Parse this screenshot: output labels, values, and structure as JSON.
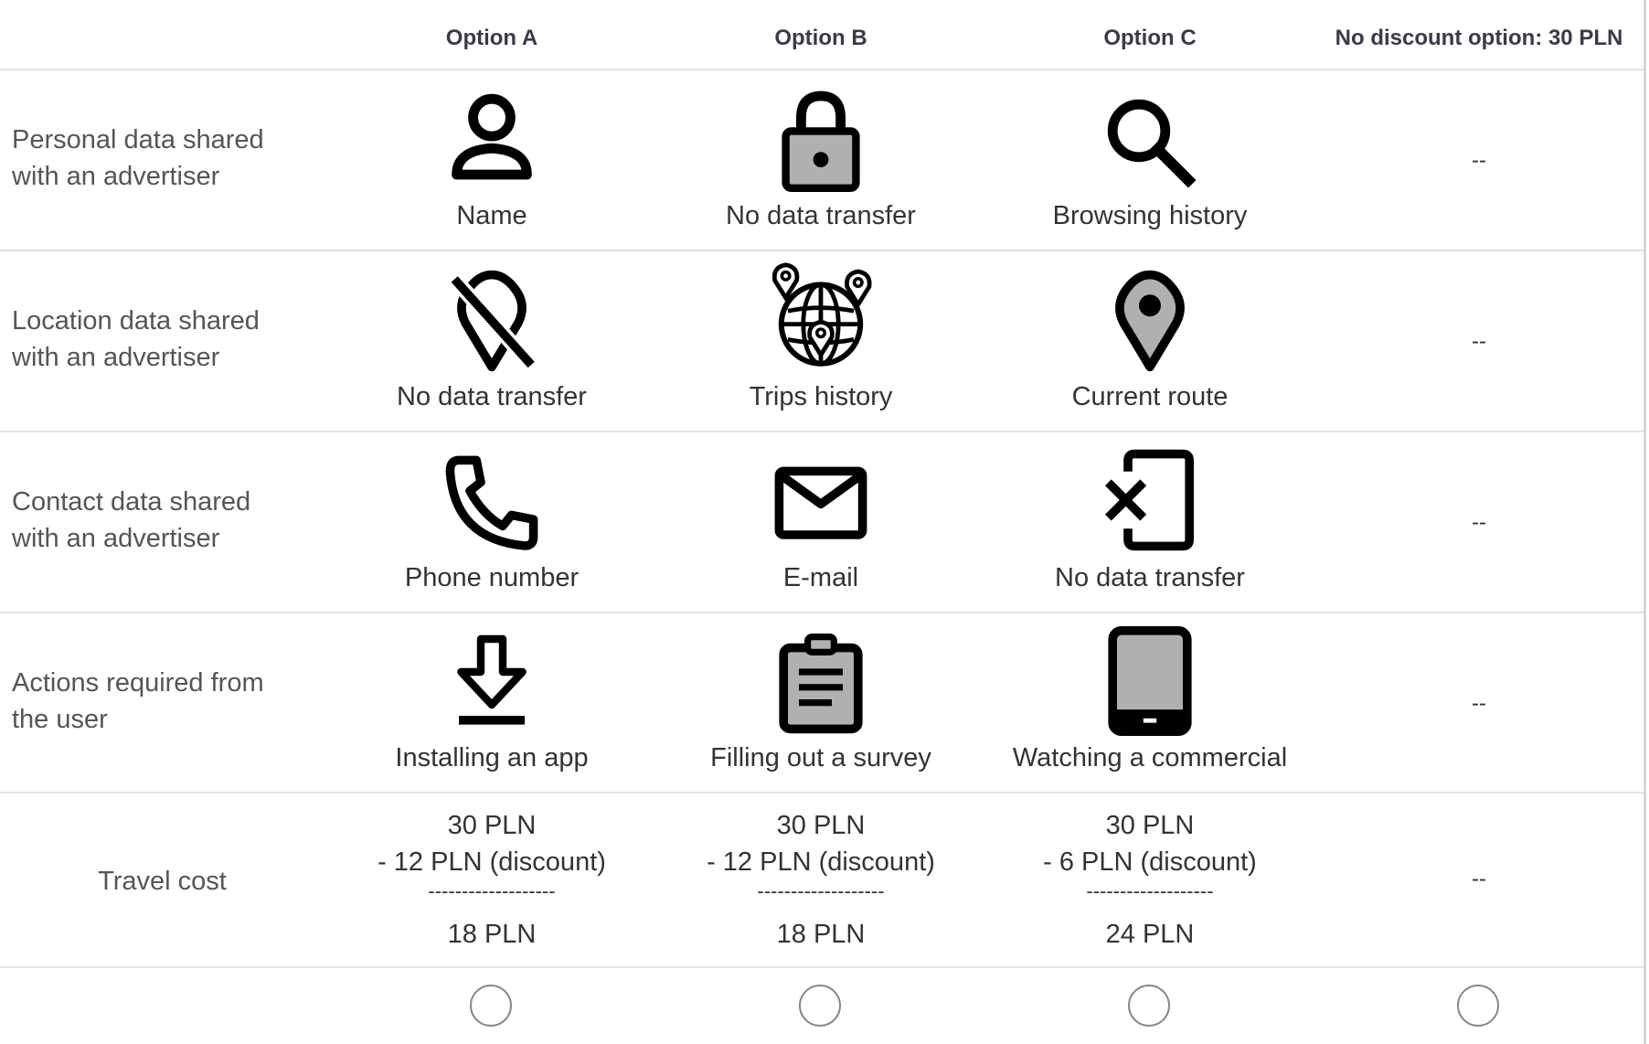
{
  "columns": [
    "Option A",
    "Option B",
    "Option C",
    "No discount option: 30 PLN"
  ],
  "rows": [
    {
      "label": [
        "Personal data shared",
        "with an advertiser"
      ],
      "options": [
        {
          "icon": "person-icon",
          "caption": "Name"
        },
        {
          "icon": "lock-icon",
          "caption": "No data transfer"
        },
        {
          "icon": "magnifier-icon",
          "caption": "Browsing history"
        }
      ],
      "none": "--"
    },
    {
      "label": [
        "Location data shared",
        "with an advertiser"
      ],
      "options": [
        {
          "icon": "location-off-icon",
          "caption": "No data transfer"
        },
        {
          "icon": "globe-pins-icon",
          "caption": "Trips history"
        },
        {
          "icon": "map-pin-icon",
          "caption": "Current route"
        }
      ],
      "none": "--"
    },
    {
      "label": [
        "Contact data shared",
        "with an advertiser"
      ],
      "options": [
        {
          "icon": "phone-icon",
          "caption": "Phone number"
        },
        {
          "icon": "envelope-icon",
          "caption": "E-mail"
        },
        {
          "icon": "phone-blocked-icon",
          "caption": "No data transfer"
        }
      ],
      "none": "--"
    },
    {
      "label": [
        "Actions required from",
        "the user"
      ],
      "options": [
        {
          "icon": "download-icon",
          "caption": "Installing an app"
        },
        {
          "icon": "clipboard-icon",
          "caption": "Filling out a survey"
        },
        {
          "icon": "tablet-icon",
          "caption": "Watching a commercial"
        }
      ],
      "none": "--"
    }
  ],
  "travel_cost": {
    "label": "Travel cost",
    "options": [
      {
        "base": "30 PLN",
        "discount": "- 12 PLN (discount)",
        "separator": "-------------------",
        "total": "18 PLN"
      },
      {
        "base": "30 PLN",
        "discount": "- 12 PLN (discount)",
        "separator": "-------------------",
        "total": "18 PLN"
      },
      {
        "base": "30 PLN",
        "discount": "- 6 PLN (discount)",
        "separator": "-------------------",
        "total": "24 PLN"
      }
    ],
    "none": "--"
  }
}
